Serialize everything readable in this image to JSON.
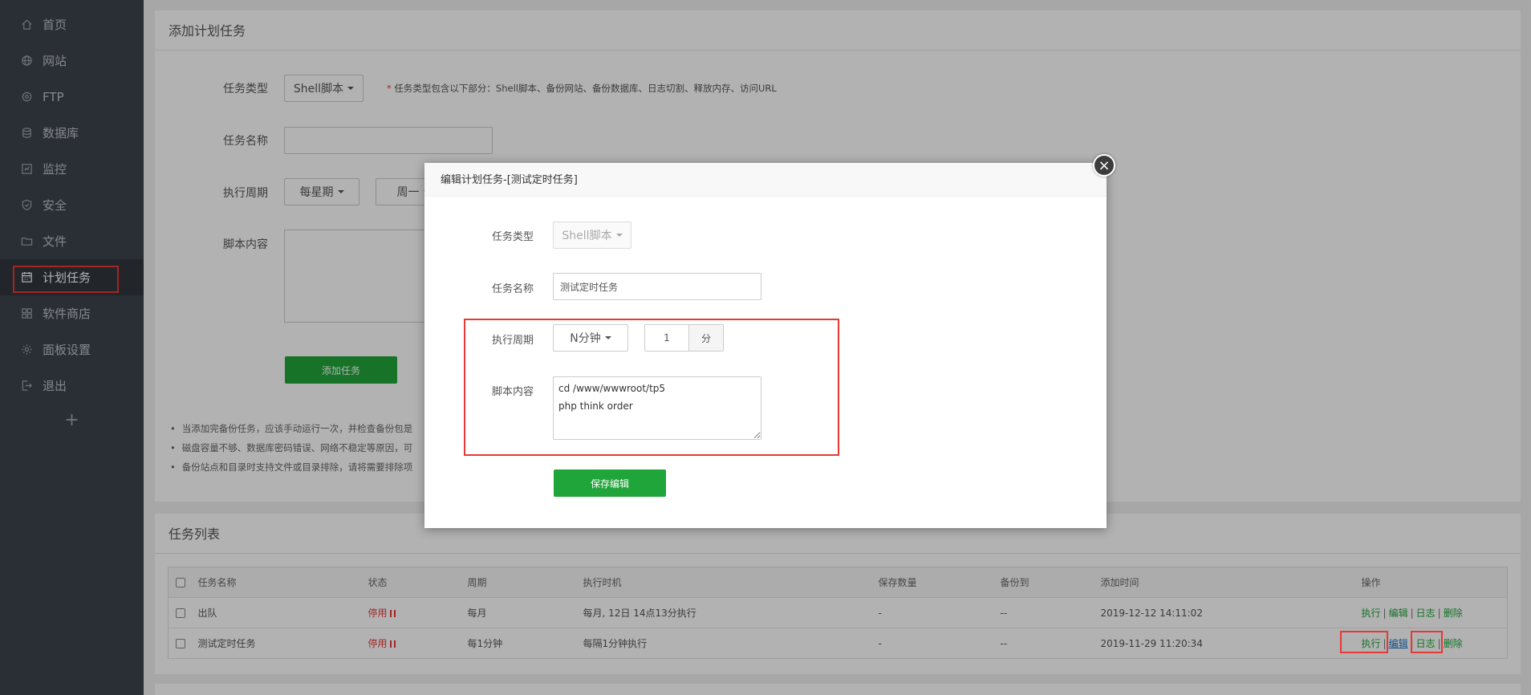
{
  "sidebar": {
    "items": [
      {
        "label": "首页",
        "icon": "home-icon"
      },
      {
        "label": "网站",
        "icon": "globe-icon"
      },
      {
        "label": "FTP",
        "icon": "ftp-icon"
      },
      {
        "label": "数据库",
        "icon": "database-icon"
      },
      {
        "label": "监控",
        "icon": "monitor-icon"
      },
      {
        "label": "安全",
        "icon": "shield-icon"
      },
      {
        "label": "文件",
        "icon": "folder-icon"
      },
      {
        "label": "计划任务",
        "icon": "calendar-icon",
        "active": true
      },
      {
        "label": "软件商店",
        "icon": "grid-icon"
      },
      {
        "label": "面板设置",
        "icon": "gear-icon"
      },
      {
        "label": "退出",
        "icon": "logout-icon"
      }
    ],
    "add_label": "+"
  },
  "add_task": {
    "title": "添加计划任务",
    "type_label": "任务类型",
    "type_value": "Shell脚本",
    "type_hint_star": "*",
    "type_hint": "任务类型包含以下部分：Shell脚本、备份网站、备份数据库、日志切割、释放内存、访问URL",
    "name_label": "任务名称",
    "name_value": "",
    "cycle_label": "执行周期",
    "cycle_value": "每星期",
    "day_value": "周一",
    "script_label": "脚本内容",
    "submit_label": "添加任务",
    "tips": [
      "当添加完备份任务，应该手动运行一次，并检查备份包是",
      "磁盘容量不够、数据库密码错误、网络不稳定等原因，可",
      "备份站点和目录时支持文件或目录排除，请将需要排除项"
    ]
  },
  "task_list": {
    "title": "任务列表",
    "columns": [
      "任务名称",
      "状态",
      "周期",
      "执行时机",
      "保存数量",
      "备份到",
      "添加时间",
      "操作"
    ],
    "rows": [
      {
        "name": "出队",
        "status": "停用",
        "cycle": "每月",
        "timing": "每月, 12日 14点13分执行",
        "keep": "-",
        "backup_to": "--",
        "added": "2019-12-12 14:11:02"
      },
      {
        "name": "测试定时任务",
        "status": "停用",
        "cycle": "每1分钟",
        "timing": "每隔1分钟执行",
        "keep": "-",
        "backup_to": "--",
        "added": "2019-11-29 11:20:34"
      }
    ],
    "actions": {
      "run": "执行",
      "edit": "编辑",
      "log": "日志",
      "delete": "删除",
      "sep": "|"
    }
  },
  "modal": {
    "title": "编辑计划任务-[测试定时任务]",
    "close_icon": "close-icon",
    "type_label": "任务类型",
    "type_value": "Shell脚本",
    "name_label": "任务名称",
    "name_value": "测试定时任务",
    "cycle_label": "执行周期",
    "cycle_value": "N分钟",
    "interval_value": "1",
    "interval_unit": "分",
    "script_label": "脚本内容",
    "script_value": "cd /www/wwwroot/tp5\nphp think order",
    "save_label": "保存编辑"
  },
  "colors": {
    "accent": "#20a53a",
    "sidebar": "#3c444d",
    "highlight": "#e53935",
    "status_off": "#e53935"
  }
}
